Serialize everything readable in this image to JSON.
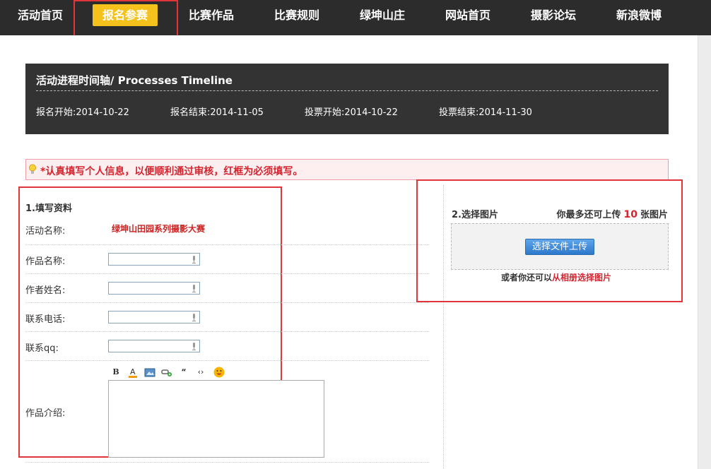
{
  "nav": {
    "items": [
      "活动首页",
      "报名参赛",
      "比赛作品",
      "比赛规则",
      "绿坤山庄",
      "网站首页",
      "摄影论坛",
      "新浪微博"
    ],
    "active_index": 1,
    "active_color": "#f5c21b",
    "bg_color": "#2c2c2c"
  },
  "timeline": {
    "title": "活动进程时间轴/ Processes Timeline",
    "items": [
      "报名开始:2014-10-22",
      "报名结束:2014-11-05",
      "投票开始:2014-10-22",
      "投票结束:2014-11-30"
    ]
  },
  "notice": {
    "icon": "lightbulb-icon",
    "text": "*认真填写个人信息，以便顺利通过审核，红框为必须填写。"
  },
  "form": {
    "title": "1.填写资料",
    "activity_label": "活动名称:",
    "activity_name": "绿坤山田园系列摄影大赛",
    "fields": [
      {
        "label": "作品名称:",
        "value": ""
      },
      {
        "label": "作者姓名:",
        "value": ""
      },
      {
        "label": "联系电话:",
        "value": ""
      },
      {
        "label": "联系qq:",
        "value": ""
      }
    ],
    "intro_label": "作品介绍:",
    "toolbar": [
      "bold-icon",
      "font-color-icon",
      "image-icon",
      "link-icon",
      "quote-icon",
      "code-icon",
      "emoji-icon"
    ]
  },
  "upload": {
    "title": "2.选择图片",
    "limit_prefix": "你最多还可上传",
    "limit_count": "10",
    "limit_suffix": "张图片",
    "button_label": "选择文件上传",
    "album_prefix": "或者你还可以",
    "album_link": "从相册选择图片"
  },
  "colors": {
    "highlight": "#e2343b",
    "accent_red": "#d4252f",
    "button_blue": "#2d78cc"
  }
}
